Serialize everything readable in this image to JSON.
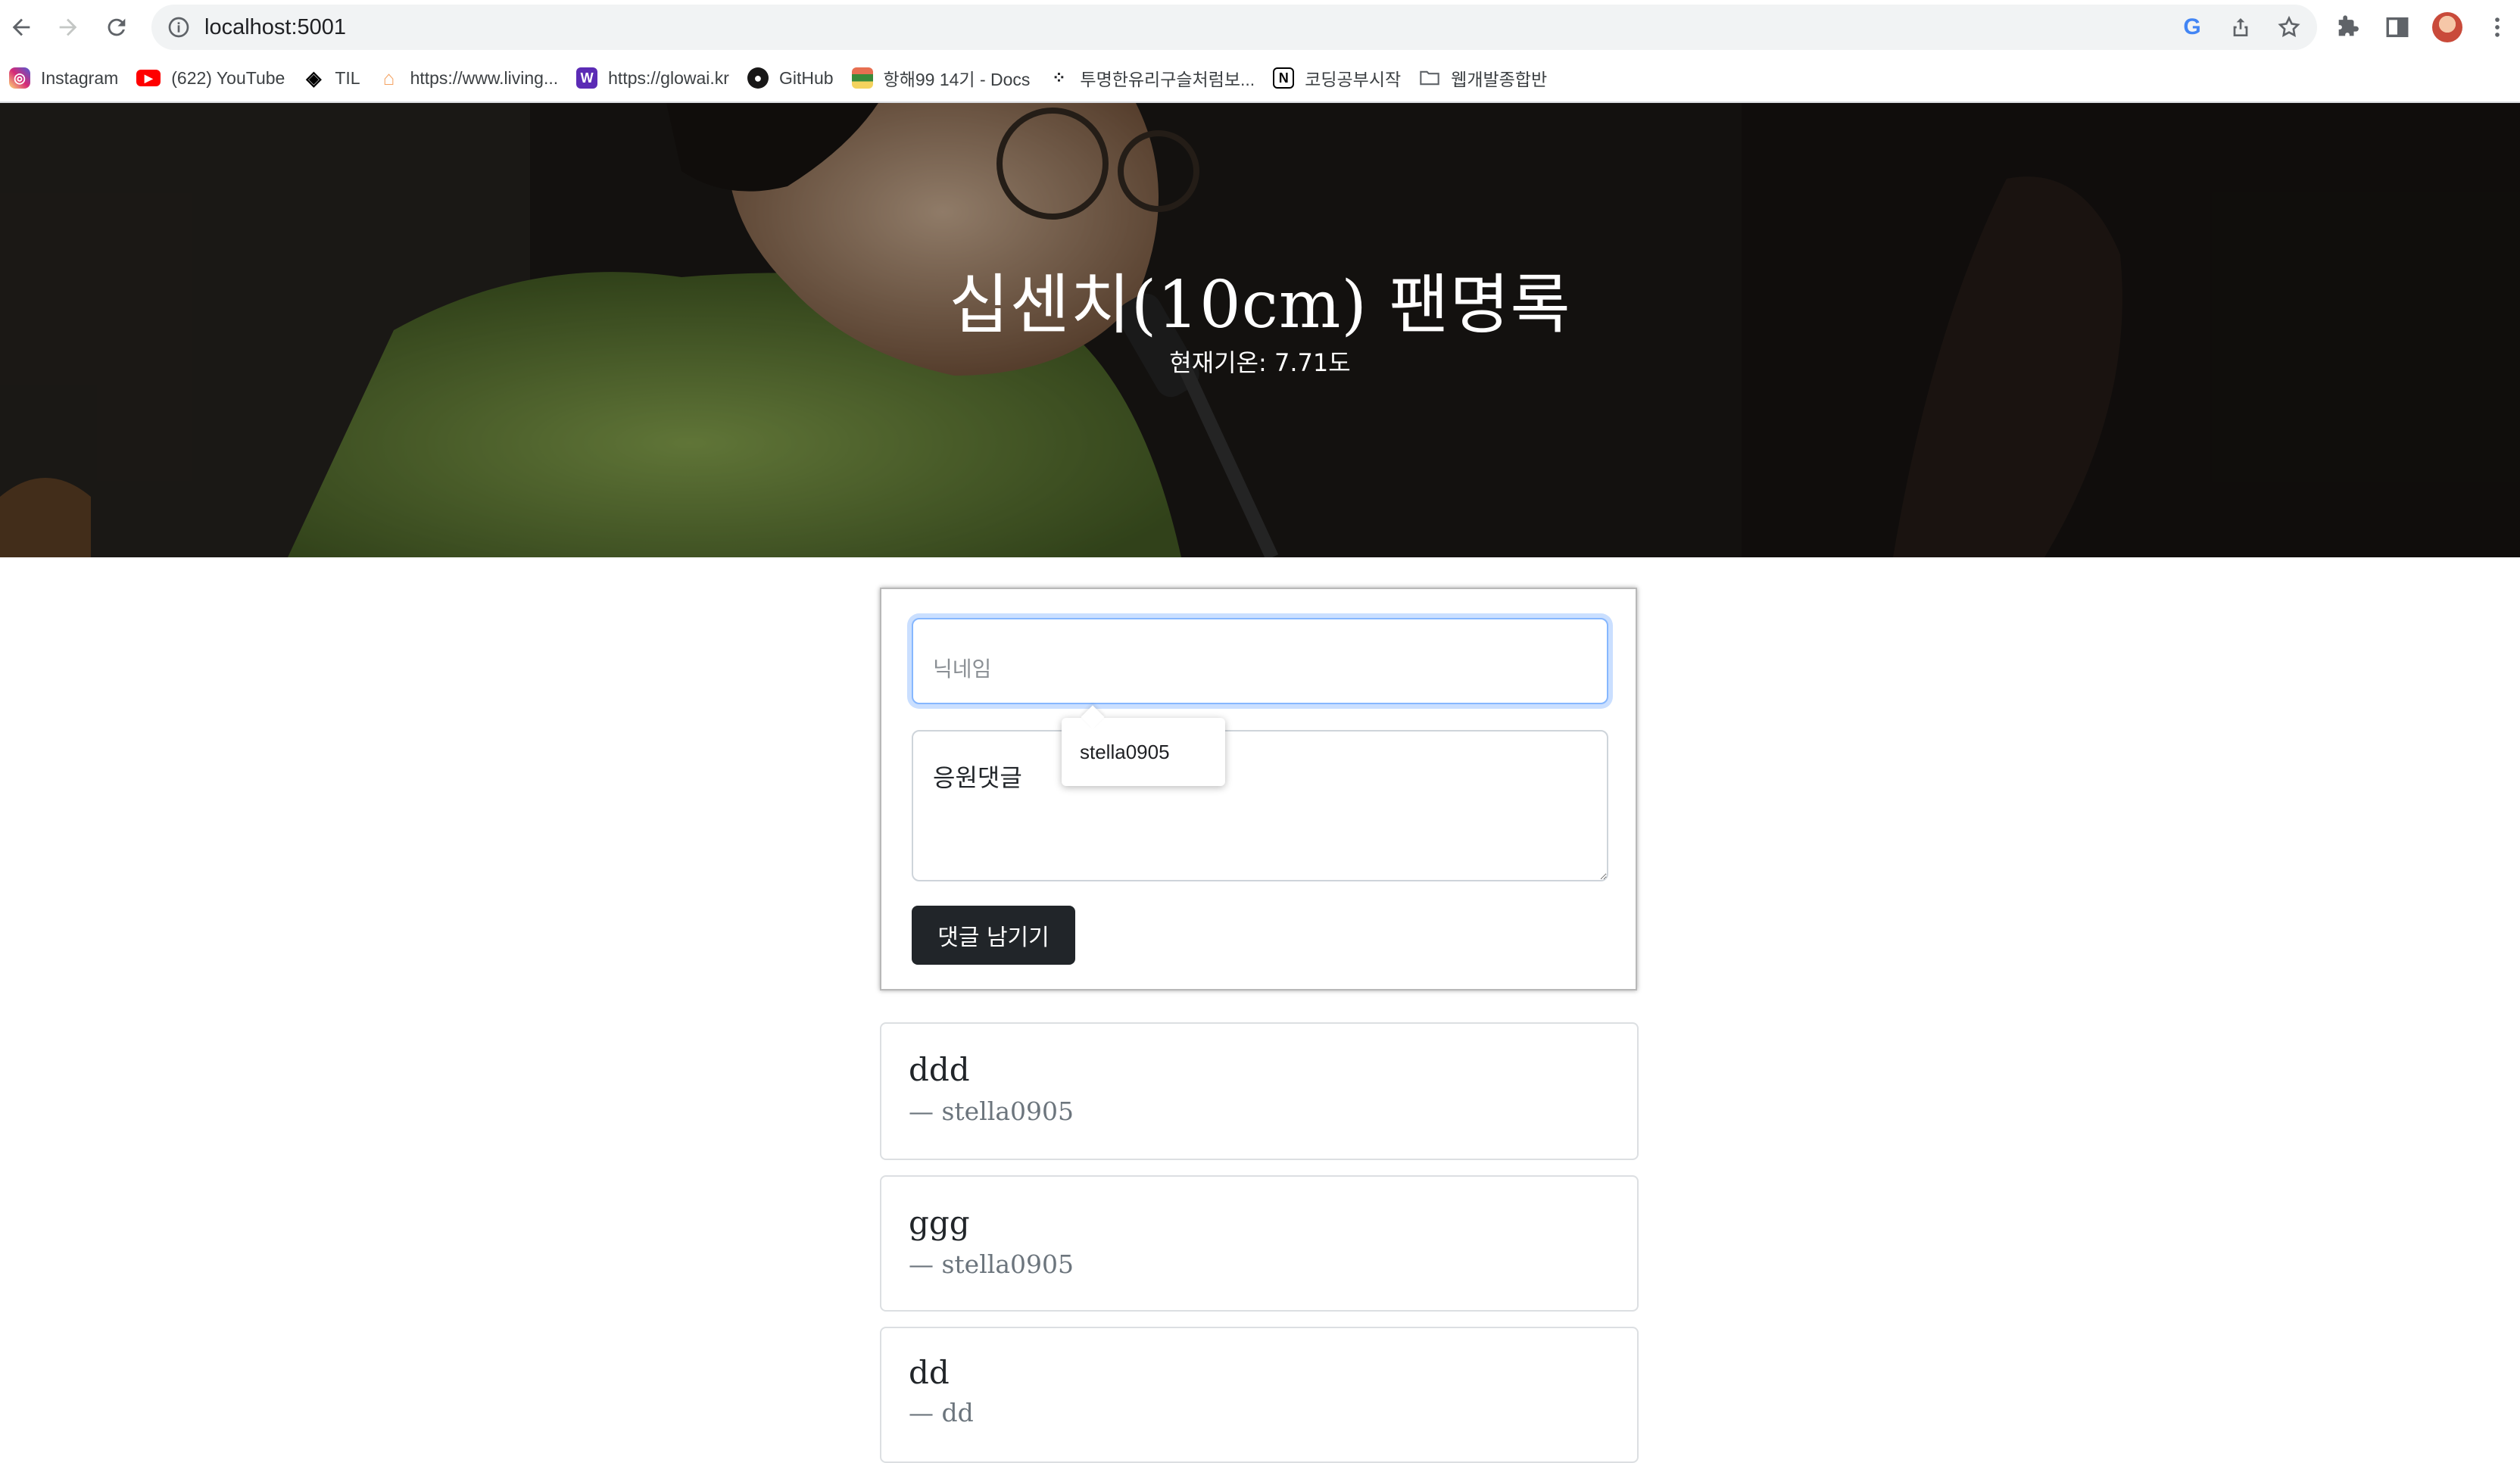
{
  "browser": {
    "url": "localhost:5001",
    "bookmarks": [
      {
        "label": "Instagram",
        "icon": "instagram-icon",
        "color": "#d6249f"
      },
      {
        "label": "(622) YouTube",
        "icon": "youtube-icon",
        "color": "#ff0000"
      },
      {
        "label": "TIL",
        "icon": "codepen-icon",
        "color": "#000000"
      },
      {
        "label": "https://www.living...",
        "icon": "home-icon",
        "color": "#f4a261"
      },
      {
        "label": "https://glowai.kr",
        "icon": "w-logo-icon",
        "color": "#5b2bb5"
      },
      {
        "label": "GitHub",
        "icon": "github-icon",
        "color": "#181717"
      },
      {
        "label": "항해99 14기 - Docs",
        "icon": "books-icon",
        "color": "#3a8a3a"
      },
      {
        "label": "투명한유리구슬처럼보...",
        "icon": "dots-icon",
        "color": "#202124"
      },
      {
        "label": "코딩공부시작",
        "icon": "notion-icon",
        "color": "#000000"
      },
      {
        "label": "웹개발종합반",
        "icon": "folder-icon",
        "color": "#5f6368"
      }
    ]
  },
  "hero": {
    "title": "십센치(10cm) 팬명록",
    "temperature": "현재기온: 7.71도"
  },
  "form": {
    "nickname_placeholder": "닉네임",
    "comment_placeholder": "응원댓글",
    "submit_label": "댓글 남기기",
    "autocomplete_suggestion": "stella0905"
  },
  "comments": [
    {
      "text": "ddd",
      "author": "— stella0905"
    },
    {
      "text": "ggg",
      "author": "— stella0905"
    },
    {
      "text": "dd",
      "author": "— dd"
    }
  ],
  "colors": {
    "accent_focus": "#86b7fe",
    "button_dark": "#212529",
    "muted_text": "#6c757d"
  }
}
